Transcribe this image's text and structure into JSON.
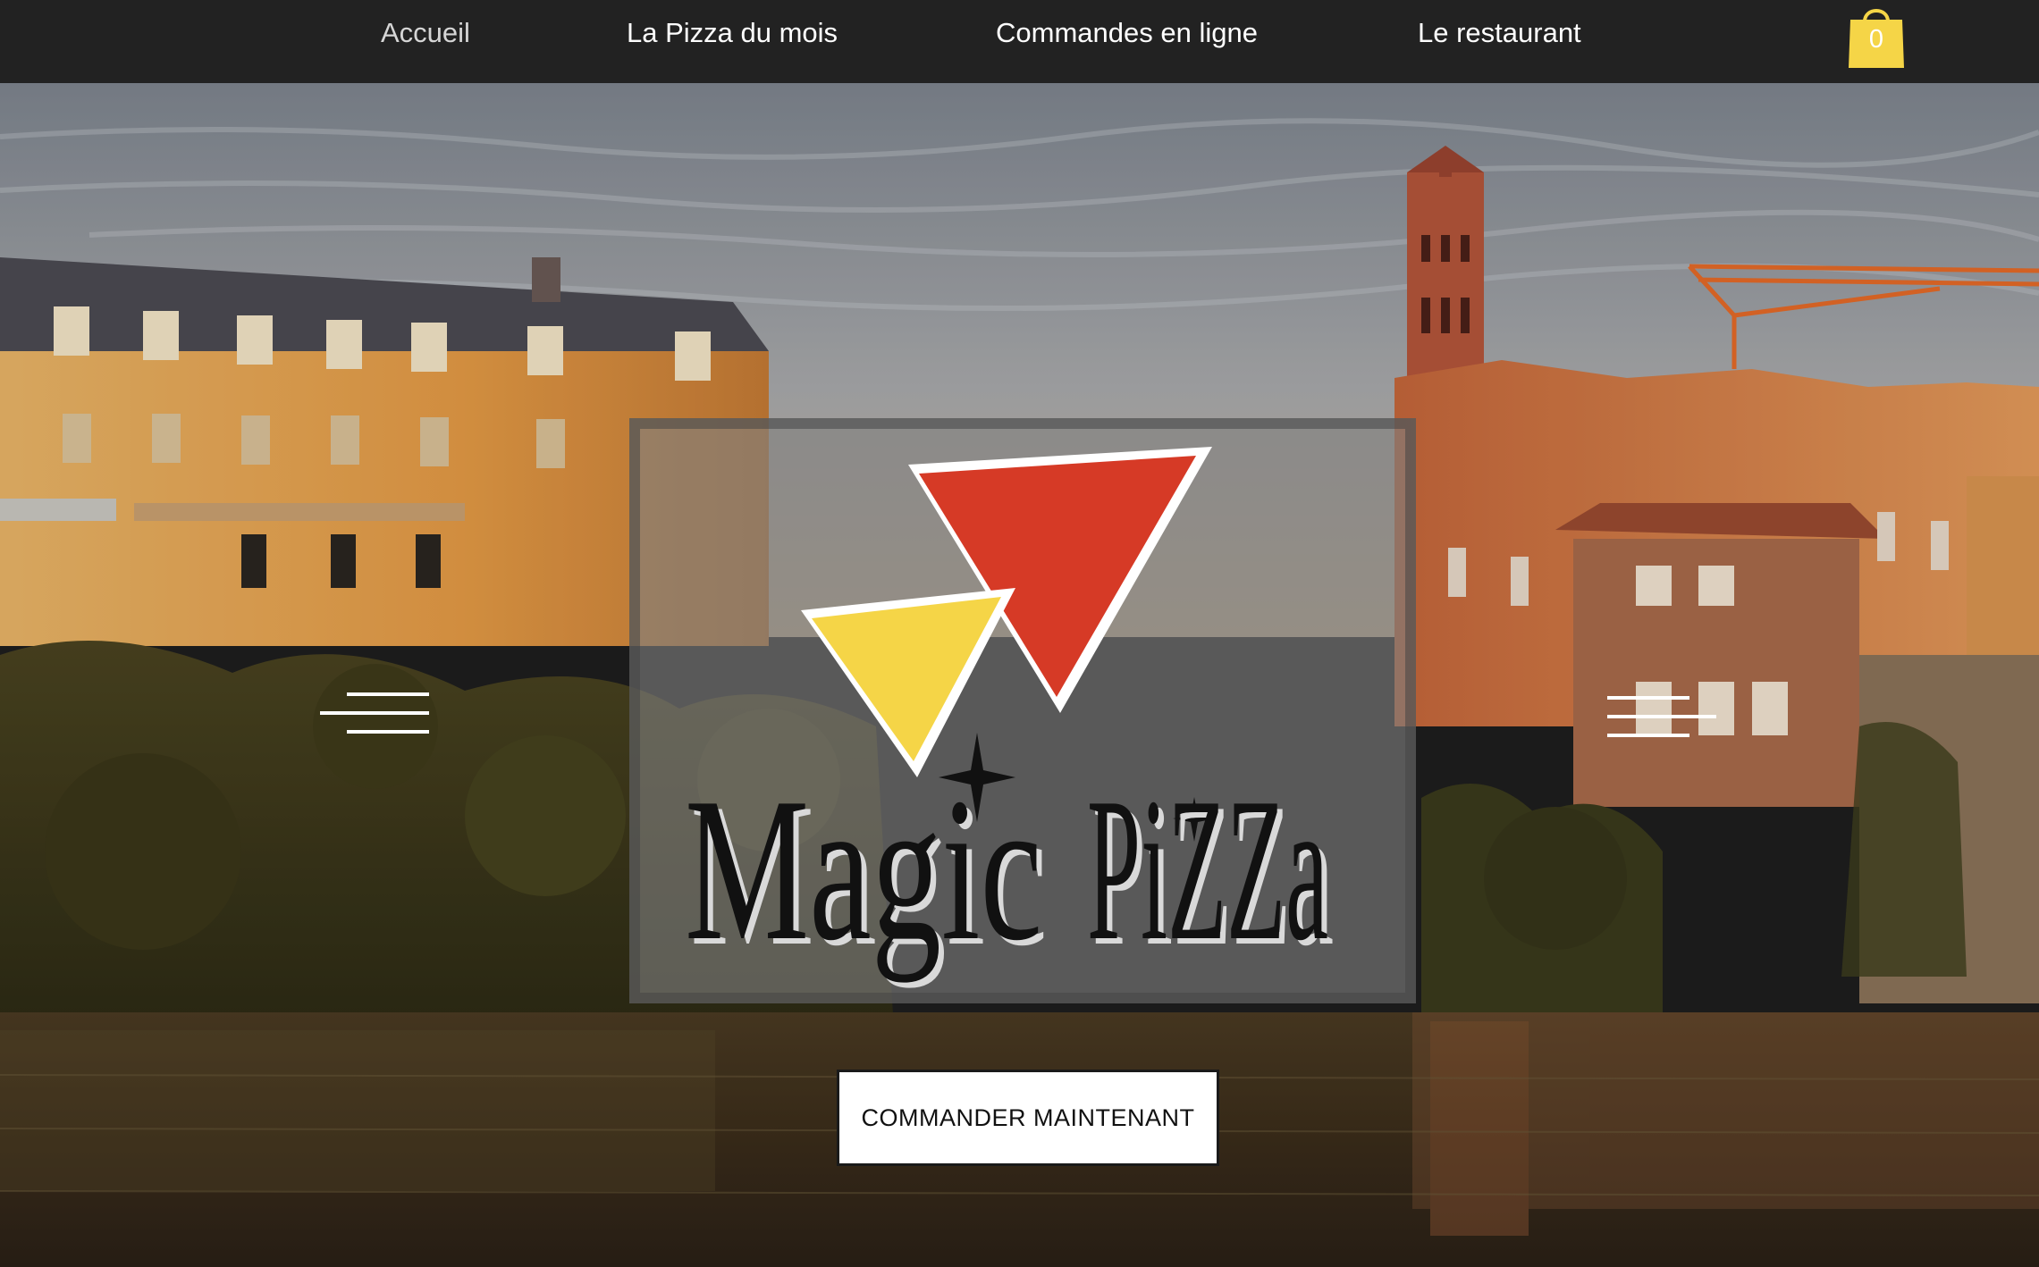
{
  "nav": {
    "items": [
      {
        "label": "Accueil",
        "active": true
      },
      {
        "label": "La Pizza du mois",
        "active": false
      },
      {
        "label": "Commandes en ligne",
        "active": false
      },
      {
        "label": "Le restaurant",
        "active": false
      }
    ],
    "cart": {
      "count": "0",
      "icon": "shopping-bag-icon",
      "color": "#f5d547"
    }
  },
  "logo": {
    "text_magic": "Magic",
    "text_pizza": "PiZZa",
    "colors": {
      "red": "#d63a26",
      "yellow": "#f5d547",
      "text": "#111111"
    }
  },
  "hero": {
    "menu_icon": "hamburger-menu-icon",
    "cta_label": "COMMANDER MAINTENANT"
  },
  "colors": {
    "navbar": "#222222",
    "accent": "#f5d547"
  }
}
